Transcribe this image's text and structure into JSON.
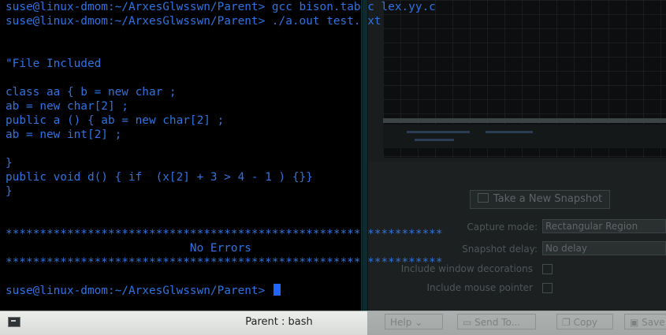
{
  "terminal": {
    "window_title": "Parent : bash",
    "prompt": "suse@linux-dmom:~/ArxesGlwsswn/Parent>",
    "lines": [
      {
        "prompt": "suse@linux-dmom:~/ArxesGlwsswn/Parent>",
        "text": " gcc bison.tab.c lex.yy.c"
      },
      {
        "prompt": "suse@linux-dmom:~/ArxesGlwsswn/Parent>",
        "text": " ./a.out test.txt"
      },
      {
        "prompt": "",
        "text": ""
      },
      {
        "prompt": "",
        "text": ""
      },
      {
        "prompt": "",
        "text": "\"File Included"
      },
      {
        "prompt": "",
        "text": ""
      },
      {
        "prompt": "",
        "text": "class aa { b = new char ;"
      },
      {
        "prompt": "",
        "text": "ab = new char[2] ;"
      },
      {
        "prompt": "",
        "text": "public a () { ab = new char[2] ;"
      },
      {
        "prompt": "",
        "text": "ab = new int[2] ;"
      },
      {
        "prompt": "",
        "text": ""
      },
      {
        "prompt": "",
        "text": "}"
      },
      {
        "prompt": "",
        "text": "public void d() { if  (x[2] + 3 > 4 - 1 ) {}}"
      },
      {
        "prompt": "",
        "text": "}"
      },
      {
        "prompt": "",
        "text": ""
      },
      {
        "prompt": "",
        "text": ""
      },
      {
        "prompt": "",
        "text": "****************************************************************"
      },
      {
        "prompt": "",
        "text": "                           No Errors"
      },
      {
        "prompt": "",
        "text": "****************************************************************"
      },
      {
        "prompt": "",
        "text": ""
      },
      {
        "prompt": "suse@linux-dmom:~/ArxesGlwsswn/Parent>",
        "text": " "
      }
    ]
  },
  "snapshot_dialog": {
    "new_snapshot_button": "Take a New Snapshot",
    "capture_mode_label": "Capture mode:",
    "capture_mode_value": "Rectangular Region",
    "snapshot_delay_label": "Snapshot delay:",
    "snapshot_delay_value": "No delay",
    "include_decorations_label": "Include window decorations",
    "include_pointer_label": "Include mouse pointer",
    "help_button": "Help",
    "send_to_button": "Send To...",
    "copy_button": "Copy",
    "save_button": "Save"
  },
  "taskbar": {
    "title": "Parent : bash"
  },
  "colors": {
    "terminal_text": "#2f73e0",
    "cursor": "#1f66ff",
    "terminal_bg": "#000000"
  }
}
